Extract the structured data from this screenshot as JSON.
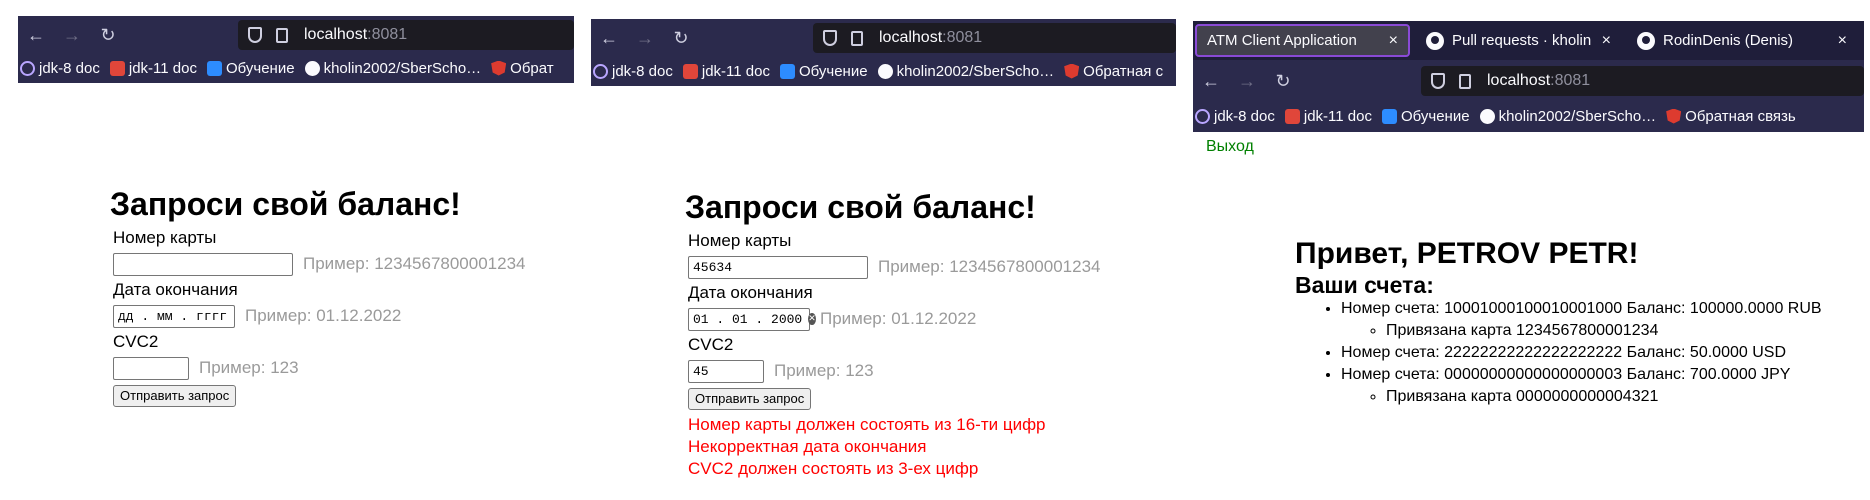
{
  "screens": [
    {
      "bookmarks": [
        "jdk-8 doc",
        "jdk-11 doc",
        "Обучение",
        "kholin2002/SberScho…",
        "Обрат"
      ],
      "url_host": "localhost",
      "url_port": ":8081",
      "form": {
        "title": "Запроси свой баланс!",
        "card_label": "Номер карты",
        "card_value": "",
        "card_hint": "Пример: 1234567800001234",
        "date_label": "Дата окончания",
        "date_value": "дд . мм . гггг",
        "date_hint": "Пример: 01.12.2022",
        "cvc_label": "CVC2",
        "cvc_value": "",
        "cvc_hint": "Пример: 123",
        "submit": "Отправить запрос"
      }
    },
    {
      "bookmarks": [
        "jdk-8 doc",
        "jdk-11 doc",
        "Обучение",
        "kholin2002/SberScho…",
        "Обратная с"
      ],
      "url_host": "localhost",
      "url_port": ":8081",
      "form": {
        "title": "Запроси свой баланс!",
        "card_label": "Номер карты",
        "card_value": "45634",
        "card_hint": "Пример: 1234567800001234",
        "date_label": "Дата окончания",
        "date_value": "01 . 01 . 2000",
        "date_hint": "Пример: 01.12.2022",
        "cvc_label": "CVC2",
        "cvc_value": "45",
        "cvc_hint": "Пример: 123",
        "submit": "Отправить запрос"
      },
      "errors": [
        "Номер карты должен состоять из 16-ти цифр",
        "Некорректная дата окончания",
        "CVC2 должен состоять из 3-ех цифр"
      ]
    },
    {
      "tabs": [
        {
          "label": "ATM Client Application",
          "close": "×",
          "active": true
        },
        {
          "label": "Pull requests · kholin2002",
          "close": "×",
          "active": false
        },
        {
          "label": "RodinDenis (Denis)",
          "close": "×",
          "active": false
        }
      ],
      "bookmarks": [
        "jdk-8 doc",
        "jdk-11 doc",
        "Обучение",
        "kholin2002/SberScho…",
        "Обратная связь"
      ],
      "url_host": "localhost",
      "url_port": ":8081",
      "logout": "Выход",
      "greeting": "Привет, PETROV PETR!",
      "accounts_title": "Ваши счета:",
      "accounts": [
        {
          "text": "Номер счета: 10001000100010001000 Баланс: 100000.0000 RUB",
          "card": "Привязана карта 1234567800001234"
        },
        {
          "text": "Номер счета: 22222222222222222222 Баланс: 50.0000 USD",
          "card": ""
        },
        {
          "text": "Номер счета: 00000000000000000003 Баланс: 700.0000 JPY",
          "card": "Привязана карта 0000000000004321"
        }
      ]
    }
  ],
  "icons": {
    "back": "←",
    "forward": "→",
    "reload": "↻"
  },
  "colors": {
    "chrome_bg": "#2b2a4c",
    "tab_active_border": "#8a4ad6",
    "hint_text": "#9a9a9a",
    "error_text": "#ff0000",
    "logout_link": "#008000"
  }
}
